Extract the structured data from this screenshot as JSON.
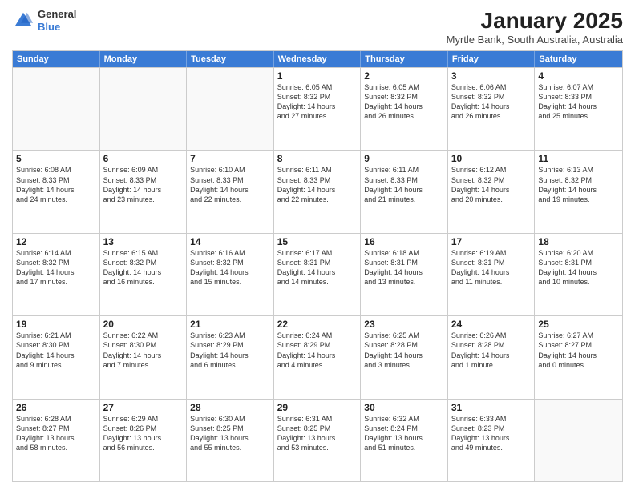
{
  "logo": {
    "general": "General",
    "blue": "Blue"
  },
  "title": "January 2025",
  "subtitle": "Myrtle Bank, South Australia, Australia",
  "days_of_week": [
    "Sunday",
    "Monday",
    "Tuesday",
    "Wednesday",
    "Thursday",
    "Friday",
    "Saturday"
  ],
  "weeks": [
    [
      {
        "day": "",
        "info": ""
      },
      {
        "day": "",
        "info": ""
      },
      {
        "day": "",
        "info": ""
      },
      {
        "day": "1",
        "info": "Sunrise: 6:05 AM\nSunset: 8:32 PM\nDaylight: 14 hours\nand 27 minutes."
      },
      {
        "day": "2",
        "info": "Sunrise: 6:05 AM\nSunset: 8:32 PM\nDaylight: 14 hours\nand 26 minutes."
      },
      {
        "day": "3",
        "info": "Sunrise: 6:06 AM\nSunset: 8:32 PM\nDaylight: 14 hours\nand 26 minutes."
      },
      {
        "day": "4",
        "info": "Sunrise: 6:07 AM\nSunset: 8:33 PM\nDaylight: 14 hours\nand 25 minutes."
      }
    ],
    [
      {
        "day": "5",
        "info": "Sunrise: 6:08 AM\nSunset: 8:33 PM\nDaylight: 14 hours\nand 24 minutes."
      },
      {
        "day": "6",
        "info": "Sunrise: 6:09 AM\nSunset: 8:33 PM\nDaylight: 14 hours\nand 23 minutes."
      },
      {
        "day": "7",
        "info": "Sunrise: 6:10 AM\nSunset: 8:33 PM\nDaylight: 14 hours\nand 22 minutes."
      },
      {
        "day": "8",
        "info": "Sunrise: 6:11 AM\nSunset: 8:33 PM\nDaylight: 14 hours\nand 22 minutes."
      },
      {
        "day": "9",
        "info": "Sunrise: 6:11 AM\nSunset: 8:33 PM\nDaylight: 14 hours\nand 21 minutes."
      },
      {
        "day": "10",
        "info": "Sunrise: 6:12 AM\nSunset: 8:32 PM\nDaylight: 14 hours\nand 20 minutes."
      },
      {
        "day": "11",
        "info": "Sunrise: 6:13 AM\nSunset: 8:32 PM\nDaylight: 14 hours\nand 19 minutes."
      }
    ],
    [
      {
        "day": "12",
        "info": "Sunrise: 6:14 AM\nSunset: 8:32 PM\nDaylight: 14 hours\nand 17 minutes."
      },
      {
        "day": "13",
        "info": "Sunrise: 6:15 AM\nSunset: 8:32 PM\nDaylight: 14 hours\nand 16 minutes."
      },
      {
        "day": "14",
        "info": "Sunrise: 6:16 AM\nSunset: 8:32 PM\nDaylight: 14 hours\nand 15 minutes."
      },
      {
        "day": "15",
        "info": "Sunrise: 6:17 AM\nSunset: 8:31 PM\nDaylight: 14 hours\nand 14 minutes."
      },
      {
        "day": "16",
        "info": "Sunrise: 6:18 AM\nSunset: 8:31 PM\nDaylight: 14 hours\nand 13 minutes."
      },
      {
        "day": "17",
        "info": "Sunrise: 6:19 AM\nSunset: 8:31 PM\nDaylight: 14 hours\nand 11 minutes."
      },
      {
        "day": "18",
        "info": "Sunrise: 6:20 AM\nSunset: 8:31 PM\nDaylight: 14 hours\nand 10 minutes."
      }
    ],
    [
      {
        "day": "19",
        "info": "Sunrise: 6:21 AM\nSunset: 8:30 PM\nDaylight: 14 hours\nand 9 minutes."
      },
      {
        "day": "20",
        "info": "Sunrise: 6:22 AM\nSunset: 8:30 PM\nDaylight: 14 hours\nand 7 minutes."
      },
      {
        "day": "21",
        "info": "Sunrise: 6:23 AM\nSunset: 8:29 PM\nDaylight: 14 hours\nand 6 minutes."
      },
      {
        "day": "22",
        "info": "Sunrise: 6:24 AM\nSunset: 8:29 PM\nDaylight: 14 hours\nand 4 minutes."
      },
      {
        "day": "23",
        "info": "Sunrise: 6:25 AM\nSunset: 8:28 PM\nDaylight: 14 hours\nand 3 minutes."
      },
      {
        "day": "24",
        "info": "Sunrise: 6:26 AM\nSunset: 8:28 PM\nDaylight: 14 hours\nand 1 minute."
      },
      {
        "day": "25",
        "info": "Sunrise: 6:27 AM\nSunset: 8:27 PM\nDaylight: 14 hours\nand 0 minutes."
      }
    ],
    [
      {
        "day": "26",
        "info": "Sunrise: 6:28 AM\nSunset: 8:27 PM\nDaylight: 13 hours\nand 58 minutes."
      },
      {
        "day": "27",
        "info": "Sunrise: 6:29 AM\nSunset: 8:26 PM\nDaylight: 13 hours\nand 56 minutes."
      },
      {
        "day": "28",
        "info": "Sunrise: 6:30 AM\nSunset: 8:25 PM\nDaylight: 13 hours\nand 55 minutes."
      },
      {
        "day": "29",
        "info": "Sunrise: 6:31 AM\nSunset: 8:25 PM\nDaylight: 13 hours\nand 53 minutes."
      },
      {
        "day": "30",
        "info": "Sunrise: 6:32 AM\nSunset: 8:24 PM\nDaylight: 13 hours\nand 51 minutes."
      },
      {
        "day": "31",
        "info": "Sunrise: 6:33 AM\nSunset: 8:23 PM\nDaylight: 13 hours\nand 49 minutes."
      },
      {
        "day": "",
        "info": ""
      }
    ]
  ]
}
